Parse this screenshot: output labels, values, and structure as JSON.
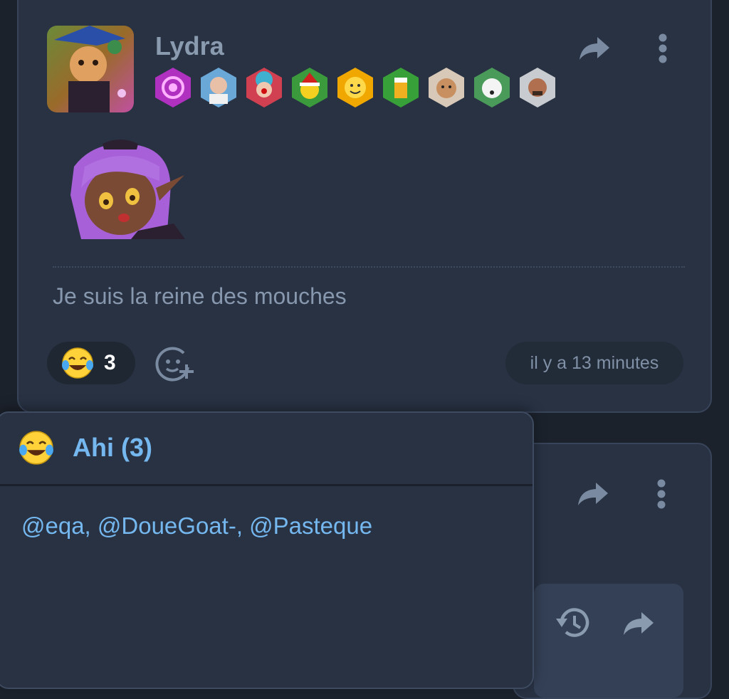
{
  "post": {
    "username": "Lydra",
    "avatar": "user-avatar",
    "badges": [
      "swirl-badge",
      "harold-badge",
      "clown-badge",
      "santa-badge",
      "smiley-badge",
      "beer-badge",
      "cat-badge",
      "dog-badge",
      "bald-man-badge"
    ],
    "sticker": "anime-girl-sticker",
    "message": "Je suis la reine des mouches",
    "reaction": {
      "emoji": "laughing-tears-emoji",
      "count": "3"
    },
    "timestamp": "il y a 13 minutes",
    "icons": {
      "share": "share-icon",
      "menu": "more-vertical-icon",
      "add_reaction": "add-reaction-icon"
    }
  },
  "popover": {
    "title": "Ahi (3)",
    "users": "@eqa, @DoueGoat-, @Pasteque"
  },
  "post2": {
    "icons": [
      "share-icon",
      "more-vertical-icon",
      "history-icon",
      "share-icon"
    ]
  },
  "colors": {
    "card": "#283243",
    "link": "#75b7ef",
    "muted": "#8797ad"
  }
}
